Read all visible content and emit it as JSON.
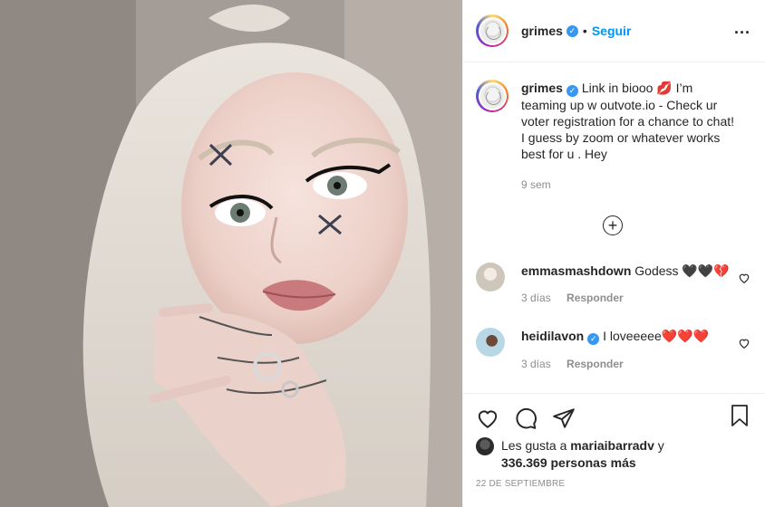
{
  "post": {
    "author": "grimes",
    "follow_label": "Seguir",
    "separator": "•",
    "more_label": "..."
  },
  "caption": {
    "author": "grimes",
    "text": "Link in biooo 💋 I’m teaming up w outvote.io - Check ur voter registration for a chance to chat! I guess by zoom or whatever works best for u . Hey",
    "time": "9 sem"
  },
  "load_more_symbol": "+",
  "comments": [
    {
      "author": "emmasmashdown",
      "text": "Godess 🖤🖤💔",
      "time": "3 días",
      "reply_label": "Responder"
    },
    {
      "author": "heidilavon",
      "text": "I loveeeee❤️❤️❤️",
      "time": "3 días",
      "reply_label": "Responder"
    }
  ],
  "likes": {
    "prefix": "Les gusta a",
    "user": "mariaibarradv",
    "connector": "y",
    "count": "336.369 personas más"
  },
  "date": "22 DE SEPTIEMBRE",
  "icons": {
    "like": "heart-icon",
    "comment": "comment-bubble-icon",
    "share": "paper-plane-icon",
    "save": "bookmark-icon",
    "verified": "verified-badge-icon"
  },
  "colors": {
    "accent": "#0095f6",
    "verified": "#3897f0",
    "muted": "#8e8e8e",
    "text": "#262626",
    "border": "#efefef"
  }
}
